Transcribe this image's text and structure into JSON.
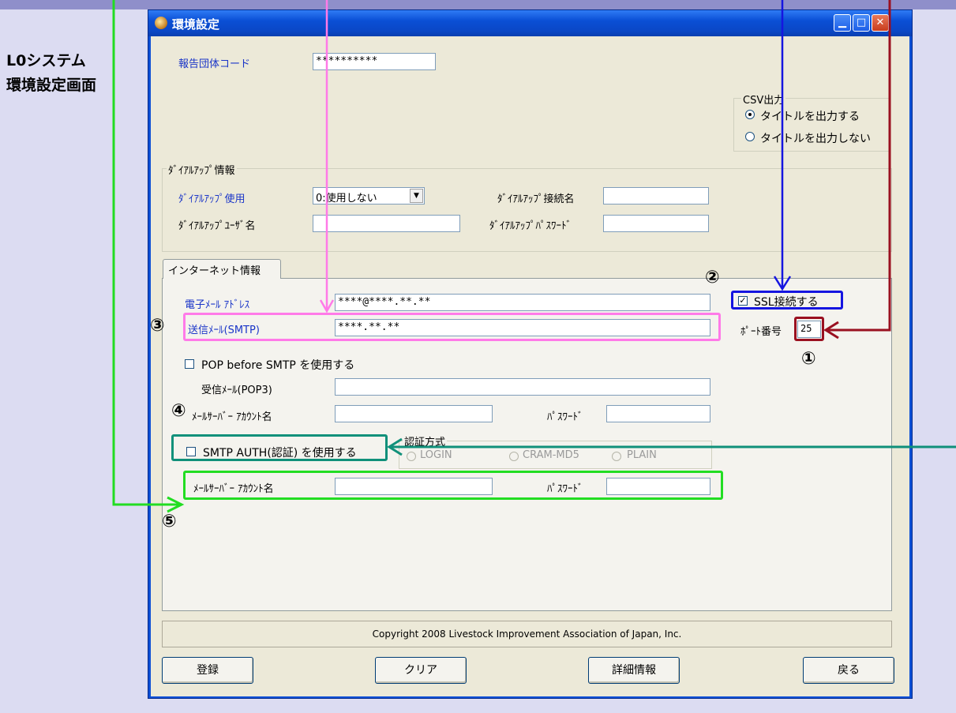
{
  "side_title": {
    "line1": "L0システム",
    "line2": "環境設定画面"
  },
  "window": {
    "title": "環境設定",
    "buttons": {
      "minimize": "▁",
      "maximize": "□",
      "close": "✕"
    }
  },
  "report_code": {
    "label": "報告団体コード",
    "value": "**********"
  },
  "csv": {
    "caption": "CSV出力",
    "option_on": "タイトルを出力する",
    "option_off": "タイトルを出力しない",
    "selected": "タイトルを出力する"
  },
  "dialup": {
    "caption": "ﾀﾞｲｱﾙｱｯﾌﾟ情報",
    "use_label": "ﾀﾞｲｱﾙｱｯﾌﾟ使用",
    "use_value": "0:使用しない",
    "conn_label": "ﾀﾞｲｱﾙｱｯﾌﾟ接続名",
    "conn_value": "",
    "user_label": "ﾀﾞｲｱﾙｱｯﾌﾟﾕｰｻﾞ名",
    "user_value": "",
    "pass_label": "ﾀﾞｲｱﾙｱｯﾌﾟﾊﾟｽﾜｰﾄﾞ",
    "pass_value": ""
  },
  "internet": {
    "tab": "インターネット情報",
    "email_label": "電子ﾒｰﾙ ｱﾄﾞﾚｽ",
    "email_value": "****@****.**.**",
    "smtp_label": "送信ﾒｰﾙ(SMTP)",
    "smtp_value": "****.**.**",
    "ssl_label": "SSL接続する",
    "ssl_checked": true,
    "port_label": "ﾎﾟｰﾄ番号",
    "port_value": "25",
    "pop_label": "POP before SMTP を使用する",
    "pop3_label": "受信ﾒｰﾙ(POP3)",
    "pop3_value": "",
    "mail_account_label": "ﾒｰﾙｻｰﾊﾞｰ ｱｶｳﾝﾄ名",
    "mail_account_value": "",
    "mail_pass_label": "ﾊﾟｽﾜｰﾄﾞ",
    "mail_pass_value": "",
    "smtp_auth_label": "SMTP AUTH(認証) を使用する",
    "auth_caption": "認証方式",
    "auth_options": [
      "LOGIN",
      "CRAM-MD5",
      "PLAIN"
    ],
    "auth_account_label": "ﾒｰﾙｻｰﾊﾞｰ ｱｶｳﾝﾄ名",
    "auth_account_value": "",
    "auth_pass_label": "ﾊﾟｽﾜｰﾄﾞ",
    "auth_pass_value": ""
  },
  "copyright": "Copyright 2008 Livestock Improvement Association of Japan, Inc.",
  "buttons": {
    "register": "登録",
    "clear": "クリア",
    "details": "詳細情報",
    "back": "戻る"
  },
  "callouts": {
    "n1": "①",
    "n2": "②",
    "n3": "③",
    "n4": "④",
    "n5": "⑤"
  },
  "colors": {
    "green": "#22dd22",
    "pink": "#ff7ae8",
    "blue": "#1515e0",
    "darkred": "#9a1020",
    "teal": "#10907a"
  }
}
